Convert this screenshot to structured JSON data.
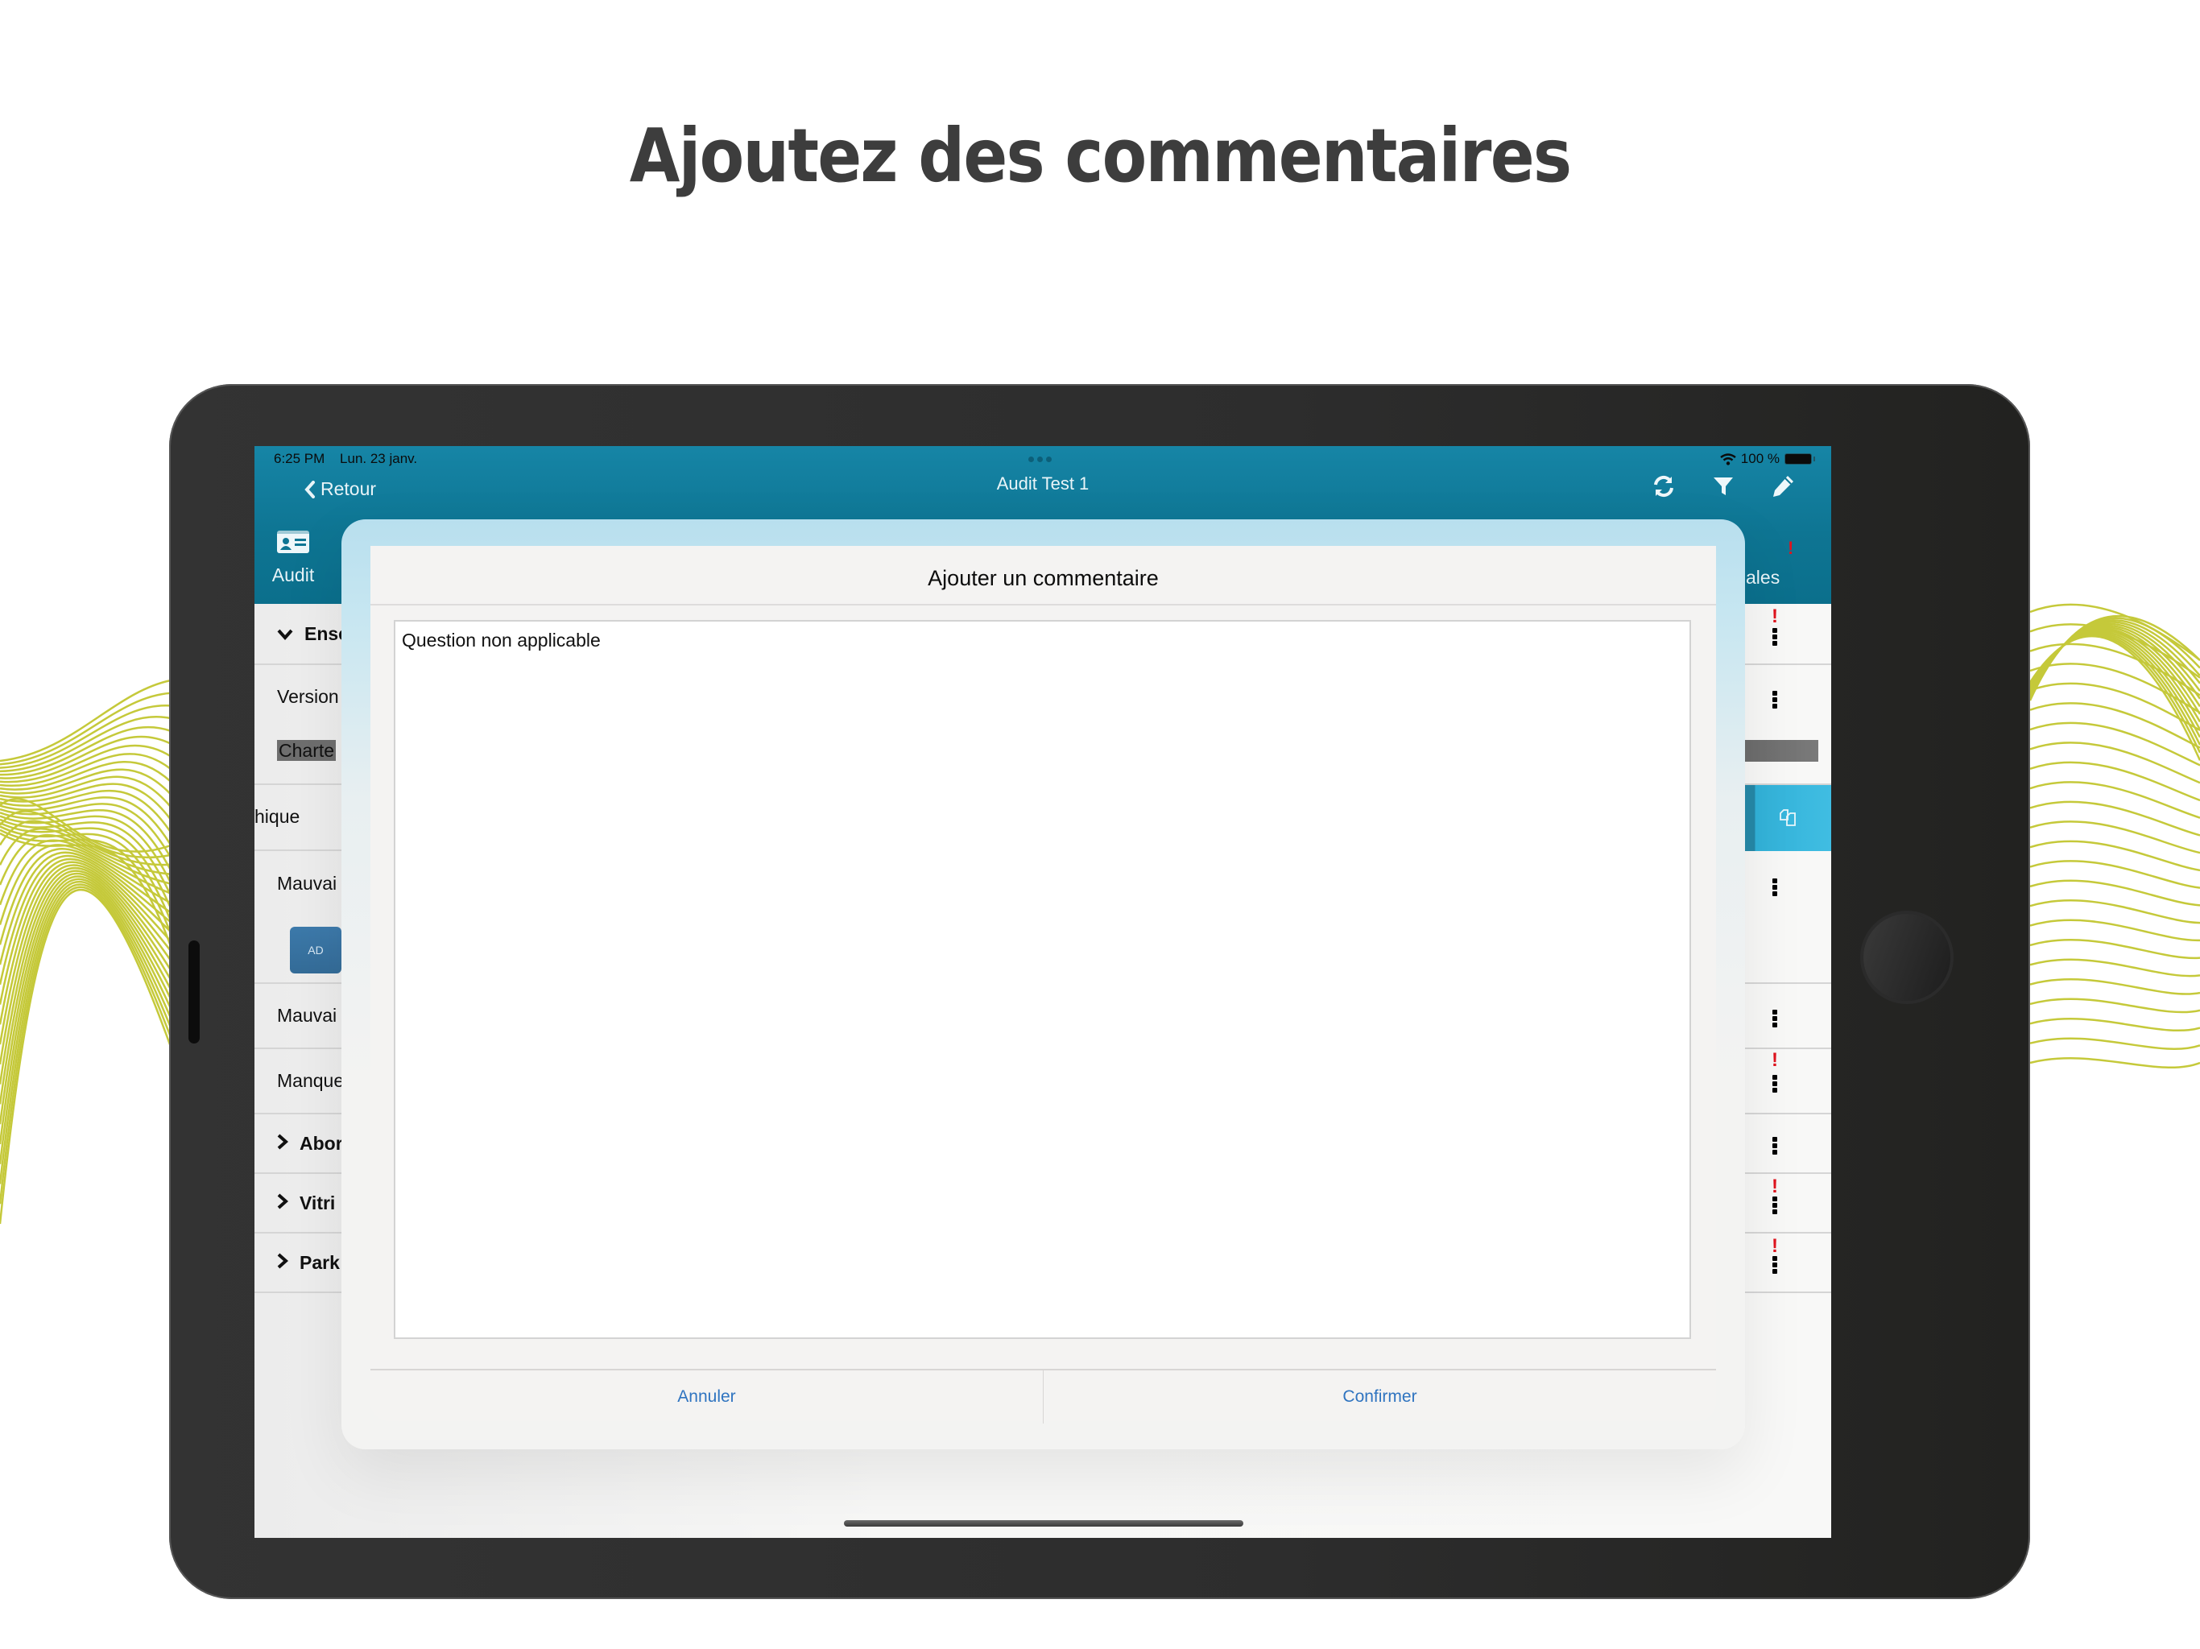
{
  "headline": "Ajoutez des commentaires",
  "colors": {
    "accent_teal": "#0e7593",
    "wave": "#c5c93a",
    "alert_red": "#e0141e",
    "link_blue": "#2f74c0",
    "copy_cell": "#40bde2",
    "ad_button": "#3d7aab"
  },
  "status_bar": {
    "time": "6:25 PM",
    "date": "Lun. 23 janv.",
    "battery": "100 %",
    "wifi_icon": "wifi-icon",
    "battery_icon": "battery-icon"
  },
  "navbar": {
    "back_label": "Retour",
    "back_icon": "chevron-left-icon",
    "title": "Audit Test 1",
    "actions": [
      {
        "name": "refresh",
        "icon": "refresh-icon"
      },
      {
        "name": "filter",
        "icon": "filter-icon"
      },
      {
        "name": "edit",
        "icon": "pencil-icon"
      }
    ]
  },
  "tabs": {
    "audit": {
      "label": "Audit",
      "icon": "id-card-icon"
    },
    "right_label_partial": "ales",
    "right_alert": "!"
  },
  "list": {
    "rows": [
      {
        "label": "Ense",
        "type": "section-expanded",
        "chevron": "chevron-down-icon",
        "alert": true
      },
      {
        "label": "Version",
        "sublabel": "Charte",
        "type": "question",
        "alert": false
      },
      {
        "label": "hique",
        "type": "question-swiped",
        "action_icon": "copy-icon"
      },
      {
        "label": "Mauvai",
        "button": "AD",
        "type": "question",
        "alert": false
      },
      {
        "label": "Mauvai",
        "type": "question",
        "alert": false
      },
      {
        "label": "Manque",
        "type": "question",
        "alert": true
      },
      {
        "label": "Abor",
        "type": "section-collapsed",
        "chevron": "chevron-right-icon",
        "alert": false
      },
      {
        "label": "Vitri",
        "type": "section-collapsed",
        "chevron": "chevron-right-icon",
        "alert": true
      },
      {
        "label": "Park",
        "type": "section-collapsed",
        "chevron": "chevron-right-icon",
        "alert": true
      }
    ]
  },
  "modal": {
    "title": "Ajouter un commentaire",
    "comment_value": "Question non applicable",
    "cancel_label": "Annuler",
    "confirm_label": "Confirmer"
  }
}
